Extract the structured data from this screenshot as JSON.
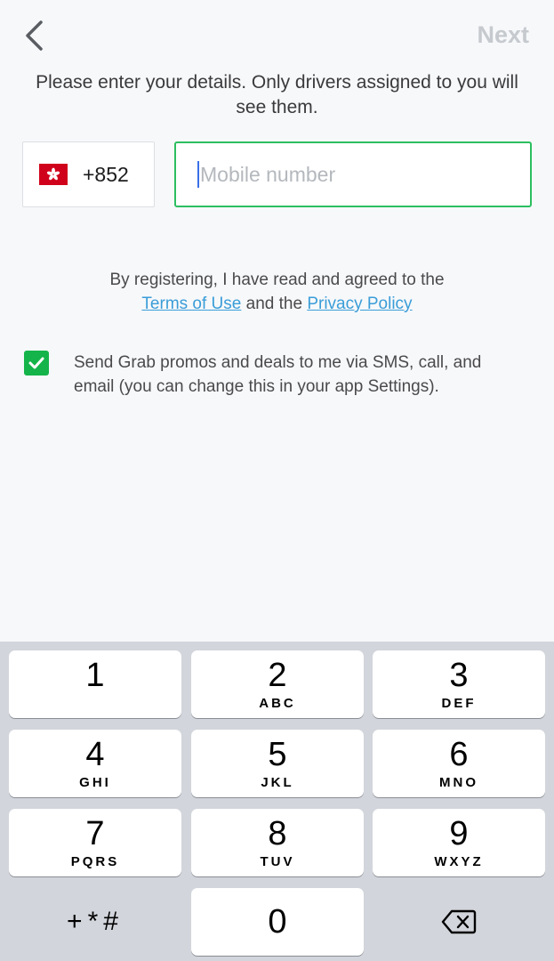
{
  "header": {
    "back_icon": "chevron-left-icon",
    "next_label": "Next",
    "next_color": "#c6cace"
  },
  "intro_text": "Please enter your details. Only drivers assigned to you will see them.",
  "country": {
    "flag": "hong-kong-flag-icon",
    "code": "+852"
  },
  "mobile": {
    "placeholder": "Mobile number",
    "value": ""
  },
  "terms": {
    "prefix": "By registering, I have read and agreed to the",
    "terms_link": "Terms of Use",
    "conjunction": "and the",
    "privacy_link": "Privacy Policy"
  },
  "promo": {
    "checked": true,
    "text": "Send Grab promos and deals to me via SMS, call, and email (you can change this in your app Settings)."
  },
  "keypad": {
    "keys": [
      {
        "digit": "1",
        "letters": ""
      },
      {
        "digit": "2",
        "letters": "ABC"
      },
      {
        "digit": "3",
        "letters": "DEF"
      },
      {
        "digit": "4",
        "letters": "GHI"
      },
      {
        "digit": "5",
        "letters": "JKL"
      },
      {
        "digit": "6",
        "letters": "MNO"
      },
      {
        "digit": "7",
        "letters": "PQRS"
      },
      {
        "digit": "8",
        "letters": "TUV"
      },
      {
        "digit": "9",
        "letters": "WXYZ"
      },
      {
        "digit": "0",
        "letters": ""
      }
    ],
    "symbols_label": "+*#",
    "delete_icon": "backspace-icon"
  },
  "colors": {
    "accent_green": "#2cbf60",
    "checkbox_green": "#14b44a",
    "link_blue": "#3a9dd8"
  }
}
